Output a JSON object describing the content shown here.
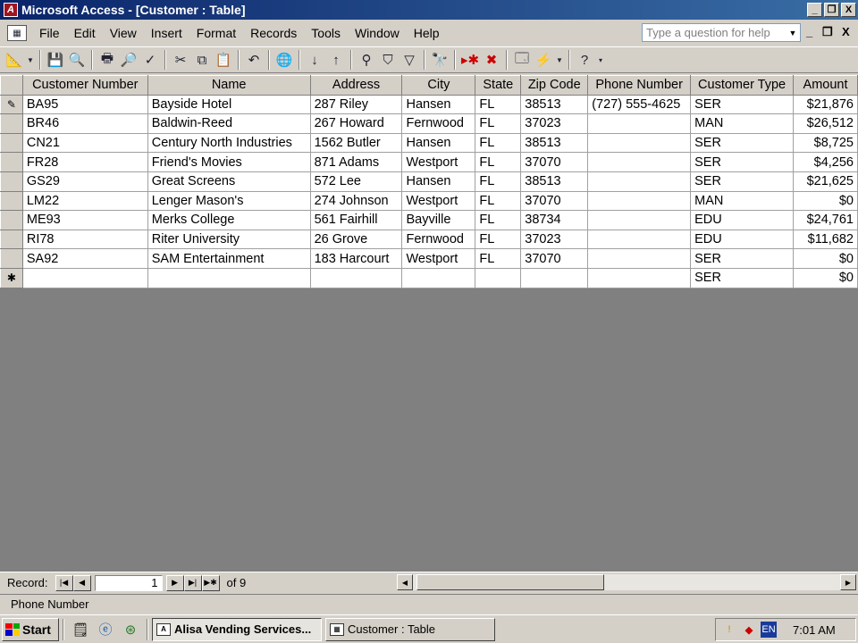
{
  "window": {
    "title": "Microsoft Access - [Customer : Table]",
    "minimize_glyph": "_",
    "restore_glyph": "❐",
    "close_glyph": "X"
  },
  "menu": {
    "items": [
      "File",
      "Edit",
      "View",
      "Insert",
      "Format",
      "Records",
      "Tools",
      "Window",
      "Help"
    ],
    "help_placeholder": "Type a question for help",
    "child_minimize": "_",
    "child_restore": "❐",
    "child_close": "X"
  },
  "toolbar": {
    "icons": [
      "design-view-icon",
      "save-icon",
      "print-preview-icon",
      "print-icon",
      "preview-icon",
      "spelling-icon",
      "cut-icon",
      "copy-icon",
      "paste-icon",
      "undo-icon",
      "hyperlink-icon",
      "sort-ascending-icon",
      "sort-descending-icon",
      "filter-by-selection-icon",
      "filter-by-form-icon",
      "apply-filter-icon",
      "find-icon",
      "new-record-icon",
      "delete-record-icon",
      "database-window-icon",
      "new-object-icon",
      "help-icon"
    ]
  },
  "table": {
    "columns": [
      "Customer Number",
      "Name",
      "Address",
      "City",
      "State",
      "Zip Code",
      "Phone Number",
      "Customer Type",
      "Amount"
    ],
    "rows": [
      [
        "BA95",
        "Bayside Hotel",
        "287 Riley",
        "Hansen",
        "FL",
        "38513",
        "(727) 555-4625",
        "SER",
        "$21,876"
      ],
      [
        "BR46",
        "Baldwin-Reed",
        "267 Howard",
        "Fernwood",
        "FL",
        "37023",
        "",
        "MAN",
        "$26,512"
      ],
      [
        "CN21",
        "Century North Industries",
        "1562 Butler",
        "Hansen",
        "FL",
        "38513",
        "",
        "SER",
        "$8,725"
      ],
      [
        "FR28",
        "Friend's Movies",
        "871 Adams",
        "Westport",
        "FL",
        "37070",
        "",
        "SER",
        "$4,256"
      ],
      [
        "GS29",
        "Great Screens",
        "572 Lee",
        "Hansen",
        "FL",
        "38513",
        "",
        "SER",
        "$21,625"
      ],
      [
        "LM22",
        "Lenger Mason's",
        "274 Johnson",
        "Westport",
        "FL",
        "37070",
        "",
        "MAN",
        "$0"
      ],
      [
        "ME93",
        "Merks College",
        "561 Fairhill",
        "Bayville",
        "FL",
        "38734",
        "",
        "EDU",
        "$24,761"
      ],
      [
        "RI78",
        "Riter University",
        "26 Grove",
        "Fernwood",
        "FL",
        "37023",
        "",
        "EDU",
        "$11,682"
      ],
      [
        "SA92",
        "SAM Entertainment",
        "183 Harcourt",
        "Westport",
        "FL",
        "37070",
        "",
        "SER",
        "$0"
      ]
    ],
    "new_row": [
      "",
      "",
      "",
      "",
      "",
      "",
      "",
      "SER",
      "$0"
    ],
    "edit_marker": "✎",
    "new_marker": "✱"
  },
  "navigation": {
    "label": "Record:",
    "current": "1",
    "of_text": "of  9"
  },
  "status": {
    "text": "Phone Number"
  },
  "taskbar": {
    "start_label": "Start",
    "tasks": [
      "Alisa Vending Services...",
      "Customer : Table"
    ],
    "tray_lang": "EN",
    "clock": "7:01 AM"
  },
  "colors": {
    "title_bar": "#0a246a",
    "window_bg": "#d4d0c8",
    "sheet_bg": "#808080"
  }
}
